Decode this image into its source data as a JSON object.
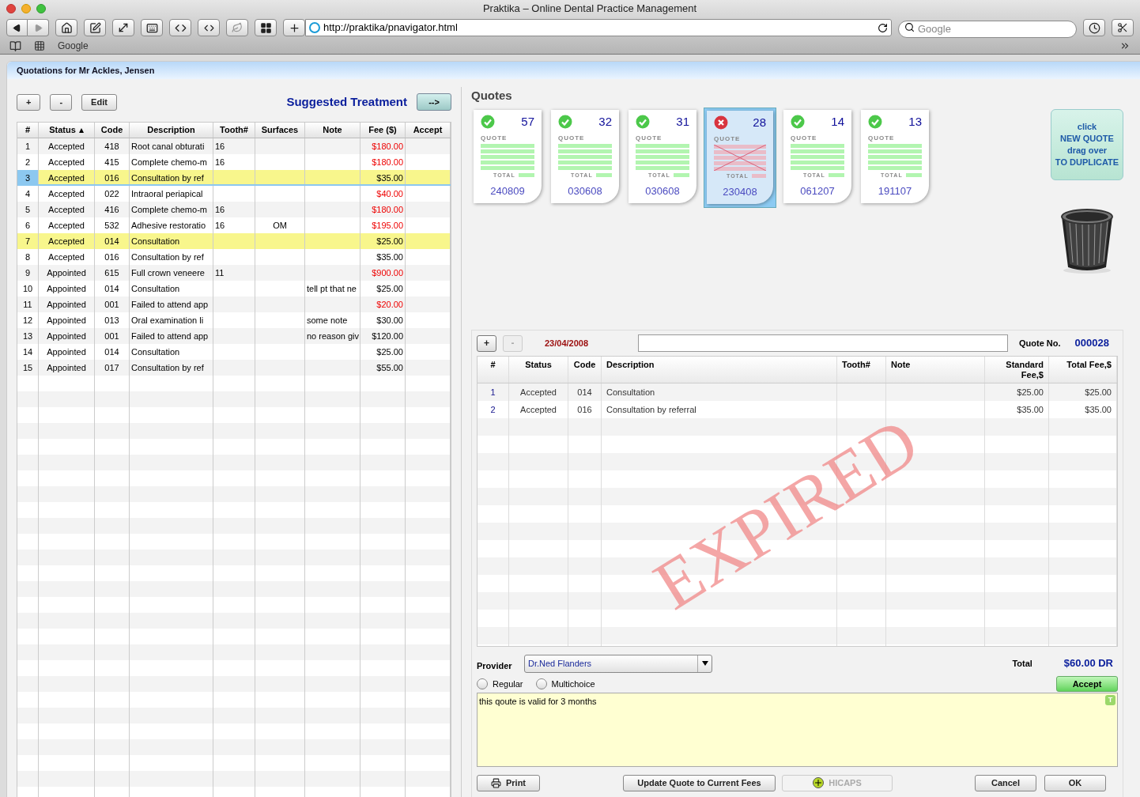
{
  "window": {
    "title": "Praktika – Online Dental Practice Management"
  },
  "browser": {
    "url": "http://praktika/pnavigator.html",
    "search_placeholder": "Google",
    "bookmarks": [
      "Google"
    ]
  },
  "page_title": "Quotations for Mr Ackles, Jensen",
  "treatment": {
    "buttons": [
      "+",
      "-",
      "Edit"
    ],
    "title": "Suggested Treatment",
    "move_button": "-->",
    "columns": [
      {
        "label": "#",
        "sorted": false
      },
      {
        "label": "Status",
        "sorted": true
      },
      {
        "label": "Code",
        "sorted": false
      },
      {
        "label": "Description",
        "sorted": false
      },
      {
        "label": "Tooth#",
        "sorted": false
      },
      {
        "label": "Surfaces",
        "sorted": false
      },
      {
        "label": "Note",
        "sorted": false
      },
      {
        "label": "Fee ($)",
        "sorted": false
      },
      {
        "label": "Accept",
        "sorted": false
      }
    ],
    "rows": [
      {
        "n": "1",
        "status": "Accepted",
        "code": "418",
        "description": "Root canal obturati",
        "tooth": "16",
        "surfaces": "",
        "note": "",
        "fee": "$180.00",
        "fee_flagged": true,
        "selected": false,
        "highlighted": false
      },
      {
        "n": "2",
        "status": "Accepted",
        "code": "415",
        "description": "Complete chemo-m",
        "tooth": "16",
        "surfaces": "",
        "note": "",
        "fee": "$180.00",
        "fee_flagged": true,
        "selected": false,
        "highlighted": false
      },
      {
        "n": "3",
        "status": "Accepted",
        "code": "016",
        "description": "Consultation by ref",
        "tooth": "",
        "surfaces": "",
        "note": "",
        "fee": "$35.00",
        "fee_flagged": false,
        "selected": true,
        "highlighted": true
      },
      {
        "n": "4",
        "status": "Accepted",
        "code": "022",
        "description": "Intraoral periapical",
        "tooth": "",
        "surfaces": "",
        "note": "",
        "fee": "$40.00",
        "fee_flagged": true,
        "selected": false,
        "highlighted": false
      },
      {
        "n": "5",
        "status": "Accepted",
        "code": "416",
        "description": "Complete chemo-m",
        "tooth": "16",
        "surfaces": "",
        "note": "",
        "fee": "$180.00",
        "fee_flagged": true,
        "selected": false,
        "highlighted": false
      },
      {
        "n": "6",
        "status": "Accepted",
        "code": "532",
        "description": "Adhesive restoratio",
        "tooth": "16",
        "surfaces": "OM",
        "note": "",
        "fee": "$195.00",
        "fee_flagged": true,
        "selected": false,
        "highlighted": false
      },
      {
        "n": "7",
        "status": "Accepted",
        "code": "014",
        "description": "Consultation",
        "tooth": "",
        "surfaces": "",
        "note": "",
        "fee": "$25.00",
        "fee_flagged": false,
        "selected": false,
        "highlighted": true
      },
      {
        "n": "8",
        "status": "Accepted",
        "code": "016",
        "description": "Consultation by ref",
        "tooth": "",
        "surfaces": "",
        "note": "",
        "fee": "$35.00",
        "fee_flagged": false,
        "selected": false,
        "highlighted": false
      },
      {
        "n": "9",
        "status": "Appointed",
        "code": "615",
        "description": "Full crown  veneere",
        "tooth": "11",
        "surfaces": "",
        "note": "",
        "fee": "$900.00",
        "fee_flagged": true,
        "selected": false,
        "highlighted": false
      },
      {
        "n": "10",
        "status": "Appointed",
        "code": "014",
        "description": "Consultation",
        "tooth": "",
        "surfaces": "",
        "note": "tell pt that ne",
        "fee": "$25.00",
        "fee_flagged": false,
        "selected": false,
        "highlighted": false
      },
      {
        "n": "11",
        "status": "Appointed",
        "code": "001",
        "description": "Failed to attend app",
        "tooth": "",
        "surfaces": "",
        "note": "",
        "fee": "$20.00",
        "fee_flagged": true,
        "selected": false,
        "highlighted": false
      },
      {
        "n": "12",
        "status": "Appointed",
        "code": "013",
        "description": "Oral examination li",
        "tooth": "",
        "surfaces": "",
        "note": "some note",
        "fee": "$30.00",
        "fee_flagged": false,
        "selected": false,
        "highlighted": false
      },
      {
        "n": "13",
        "status": "Appointed",
        "code": "001",
        "description": "Failed to attend app",
        "tooth": "",
        "surfaces": "",
        "note": "no reason giv",
        "fee": "$120.00",
        "fee_flagged": false,
        "selected": false,
        "highlighted": false
      },
      {
        "n": "14",
        "status": "Appointed",
        "code": "014",
        "description": "Consultation",
        "tooth": "",
        "surfaces": "",
        "note": "",
        "fee": "$25.00",
        "fee_flagged": false,
        "selected": false,
        "highlighted": false
      },
      {
        "n": "15",
        "status": "Appointed",
        "code": "017",
        "description": "Consultation by ref",
        "tooth": "",
        "surfaces": "",
        "note": "",
        "fee": "$55.00",
        "fee_flagged": false,
        "selected": false,
        "highlighted": false
      }
    ]
  },
  "quotes": {
    "title": "Quotes",
    "cards": [
      {
        "number": "57",
        "date": "240809",
        "expired": false,
        "selected": false,
        "label": "QUOTE",
        "total_label": "TOTAL"
      },
      {
        "number": "32",
        "date": "030608",
        "expired": false,
        "selected": false,
        "label": "QUOTE",
        "total_label": "TOTAL"
      },
      {
        "number": "31",
        "date": "030608",
        "expired": false,
        "selected": false,
        "label": "QUOTE",
        "total_label": "TOTAL"
      },
      {
        "number": "28",
        "date": "230408",
        "expired": true,
        "selected": true,
        "label": "QUOTE",
        "total_label": "TOTAL"
      },
      {
        "number": "14",
        "date": "061207",
        "expired": false,
        "selected": false,
        "label": "QUOTE",
        "total_label": "TOTAL"
      },
      {
        "number": "13",
        "date": "191107",
        "expired": false,
        "selected": false,
        "label": "QUOTE",
        "total_label": "TOTAL"
      }
    ],
    "new_quote_lines": [
      "click",
      "NEW QUOTE",
      "drag over",
      "TO DUPLICATE"
    ]
  },
  "detail": {
    "add": {
      "label": "+",
      "disabled": false
    },
    "remove": {
      "label": "-",
      "disabled": true
    },
    "date": "23/04/2008",
    "quote_no_label": "Quote No.",
    "quote_no": "000028",
    "columns": [
      "#",
      "Status",
      "Code",
      "Description",
      "Tooth#",
      "Note",
      "Standard Fee,$",
      "Total Fee,$"
    ],
    "rows": [
      {
        "n": "1",
        "status": "Accepted",
        "code": "014",
        "description": "Consultation",
        "standard_fee": "$25.00",
        "total_fee": "$25.00"
      },
      {
        "n": "2",
        "status": "Accepted",
        "code": "016",
        "description": "Consultation by referral",
        "standard_fee": "$35.00",
        "total_fee": "$35.00"
      }
    ],
    "stamp": "EXPIRED",
    "provider_label": "Provider",
    "provider": "Dr.Ned Flanders",
    "total_label": "Total",
    "total": "$60.00 DR",
    "radios": [
      {
        "label": "Regular",
        "selected": false
      },
      {
        "label": "Multichoice",
        "selected": false
      }
    ],
    "accept": "Accept",
    "notes": "this qoute is valid for 3 months",
    "notes_badge": "T",
    "buttons": [
      {
        "label": "Print",
        "kind": "print",
        "disabled": false
      },
      {
        "label": "Update Quote to Current Fees",
        "kind": "plain",
        "disabled": false
      },
      {
        "label": "HICAPS",
        "kind": "hicaps",
        "disabled": true
      },
      {
        "label": "Cancel",
        "kind": "plain",
        "disabled": false
      },
      {
        "label": "OK",
        "kind": "plain",
        "disabled": false
      }
    ]
  }
}
